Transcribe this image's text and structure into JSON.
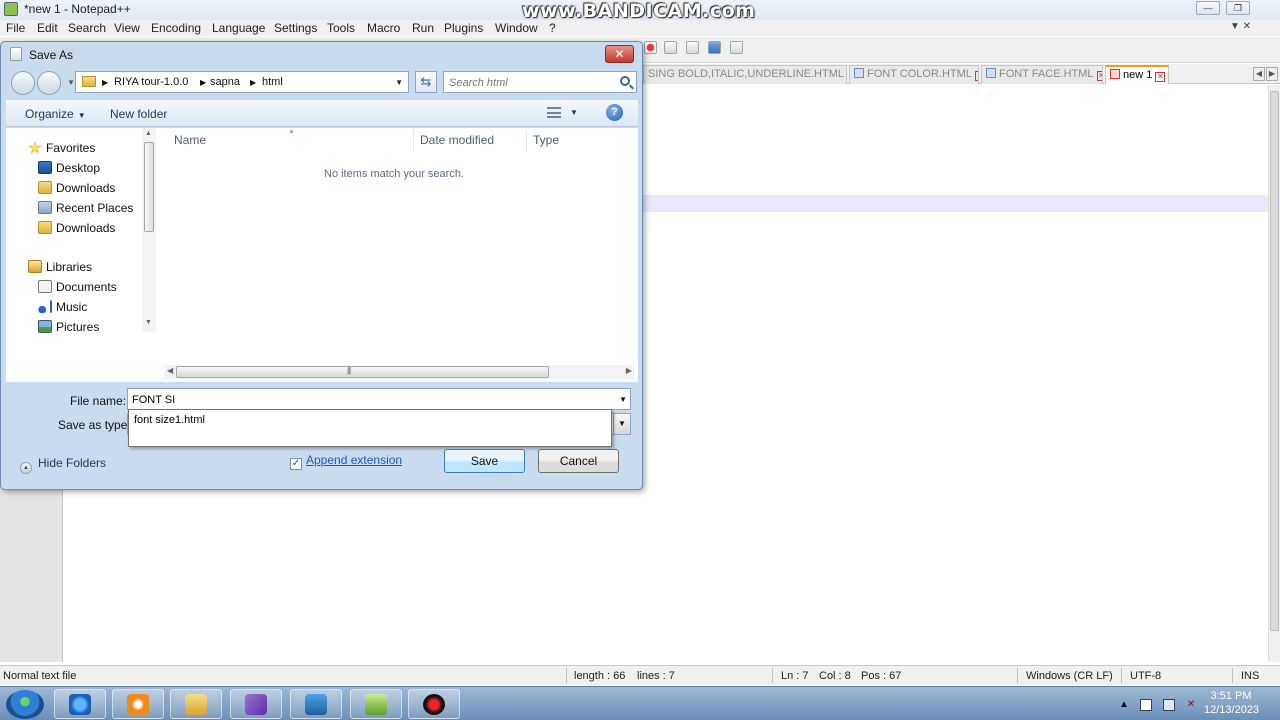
{
  "watermark": "www.BANDICAM.com",
  "notepad": {
    "title": "*new 1 - Notepad++",
    "menu": [
      "File",
      "Edit",
      "Search",
      "View",
      "Encoding",
      "Language",
      "Settings",
      "Tools",
      "Macro",
      "Run",
      "Plugins",
      "Window",
      "?"
    ],
    "menu_arrows": "▼ ✕",
    "tabs": [
      {
        "label": "SING BOLD,ITALIC,UNDERLINE.HTML",
        "active": false
      },
      {
        "label": "FONT COLOR.HTML",
        "active": false
      },
      {
        "label": "FONT FACE.HTML",
        "active": false
      },
      {
        "label": "new 1",
        "active": true
      }
    ],
    "status": {
      "mode": "Normal text file",
      "length": "length : 66",
      "lines": "lines : 7",
      "ln": "Ln : 7",
      "col": "Col : 8",
      "pos": "Pos : 67",
      "eol": "Windows (CR LF)",
      "encoding": "UTF-8",
      "ins": "INS"
    }
  },
  "dialog": {
    "title": "Save As",
    "close_label": "✕",
    "breadcrumb": [
      "RIYA tour-1.0.0",
      "sapna",
      "html"
    ],
    "search_placeholder": "Search html",
    "organize_label": "Organize",
    "new_folder_label": "New folder",
    "help_label": "?",
    "nav": {
      "favorites_label": "Favorites",
      "favorites": [
        "Desktop",
        "Downloads",
        "Recent Places",
        "Downloads"
      ],
      "libraries_label": "Libraries",
      "libraries": [
        "Documents",
        "Music",
        "Pictures"
      ]
    },
    "columns": [
      "Name",
      "Date modified",
      "Type"
    ],
    "empty_message": "No items match your search.",
    "file_name_label": "File name:",
    "file_name_value": "FONT SI",
    "save_as_type_label": "Save as type:",
    "autocomplete_suggestion": "font size1.html",
    "hide_folders_label": "Hide Folders",
    "append_extension_label": "Append extension",
    "append_extension_checked": true,
    "save_label": "Save",
    "cancel_label": "Cancel"
  },
  "taskbar": {
    "time": "3:51 PM",
    "date": "12/13/2023"
  },
  "colors": {
    "dialog_frame": "#c9dbee",
    "active_tab_accent": "#f39c12",
    "link_blue": "#1e5bb7"
  }
}
